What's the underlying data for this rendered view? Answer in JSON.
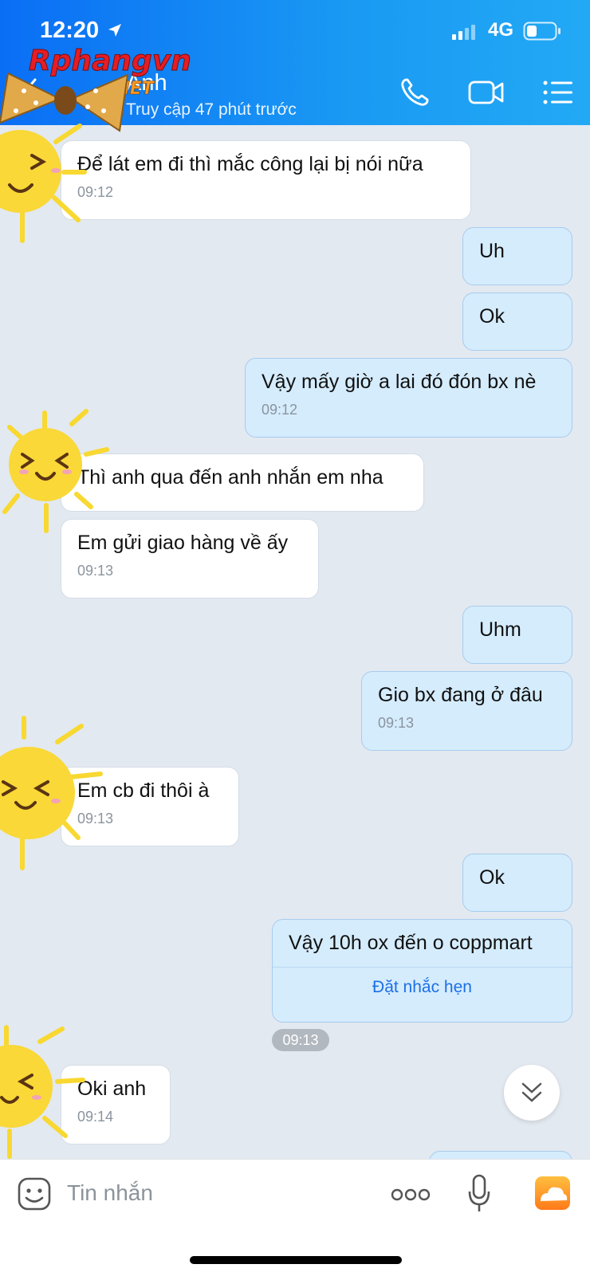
{
  "status_bar": {
    "time": "12:20",
    "network": "4G"
  },
  "header": {
    "contact_name": "Anh",
    "contact_status": "Truy cập 47 phút trước",
    "watermark_text": "Rphangvn",
    "watermark_suffix": ".NET"
  },
  "messages": [
    {
      "dir": "in",
      "text": "Để lát em đi thì mắc công lại bị nói nữa",
      "time": "09:12"
    },
    {
      "dir": "out",
      "text": "Uh",
      "time": ""
    },
    {
      "dir": "out",
      "text": "Ok",
      "time": ""
    },
    {
      "dir": "out",
      "text": "Vậy mấy giờ a lai đó đón bx nè",
      "time": "09:12"
    },
    {
      "dir": "in",
      "text": "Thì anh qua đến anh nhắn em nha",
      "time": ""
    },
    {
      "dir": "in",
      "text": "Em gửi giao hàng về ấy",
      "time": "09:13"
    },
    {
      "dir": "out",
      "text": "Uhm",
      "time": ""
    },
    {
      "dir": "out",
      "text": "Gio bx đang ở đâu",
      "time": "09:13"
    },
    {
      "dir": "in",
      "text": "Em cb đi thôi à",
      "time": "09:13"
    },
    {
      "dir": "out",
      "text": "Ok",
      "time": ""
    },
    {
      "dir": "out",
      "text": "Vậy 10h ox đến o coppmart",
      "time": "",
      "action": "Đặt nhắc hẹn"
    },
    {
      "dir": "in",
      "text": "Oki anh",
      "time": "09:14"
    }
  ],
  "time_divider": "09:13",
  "input": {
    "placeholder": "Tin nhắn"
  },
  "colors": {
    "header": "#1a9af3",
    "outgoing_bubble": "#d5ecfd",
    "incoming_bubble": "#ffffff",
    "link": "#1d6fe6"
  }
}
